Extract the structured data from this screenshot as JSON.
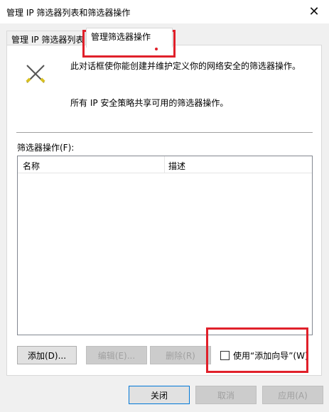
{
  "window": {
    "title": "管理 IP 筛选器列表和筛选器操作",
    "close_glyph": "✕"
  },
  "tabs": [
    {
      "label": "管理 IP 筛选器列表",
      "selected": false
    },
    {
      "label": "管理筛选器操作",
      "selected": true
    }
  ],
  "content": {
    "description_line1": "此对话框使你能创建并维护定义你的网络安全的筛选器操作。",
    "description_line2": "所有 IP 安全策略共享可用的筛选器操作。",
    "list_label": "筛选器操作(F):",
    "columns": [
      "名称",
      "描述"
    ]
  },
  "buttons": {
    "add": "添加(D)...",
    "edit": "编辑(E)...",
    "remove": "删除(R)",
    "close": "关闭",
    "cancel": "取消",
    "apply": "应用(A)"
  },
  "wizard": {
    "label": "使用“添加向导”(W)",
    "checked": false
  },
  "annotation_color": "#e0202a"
}
